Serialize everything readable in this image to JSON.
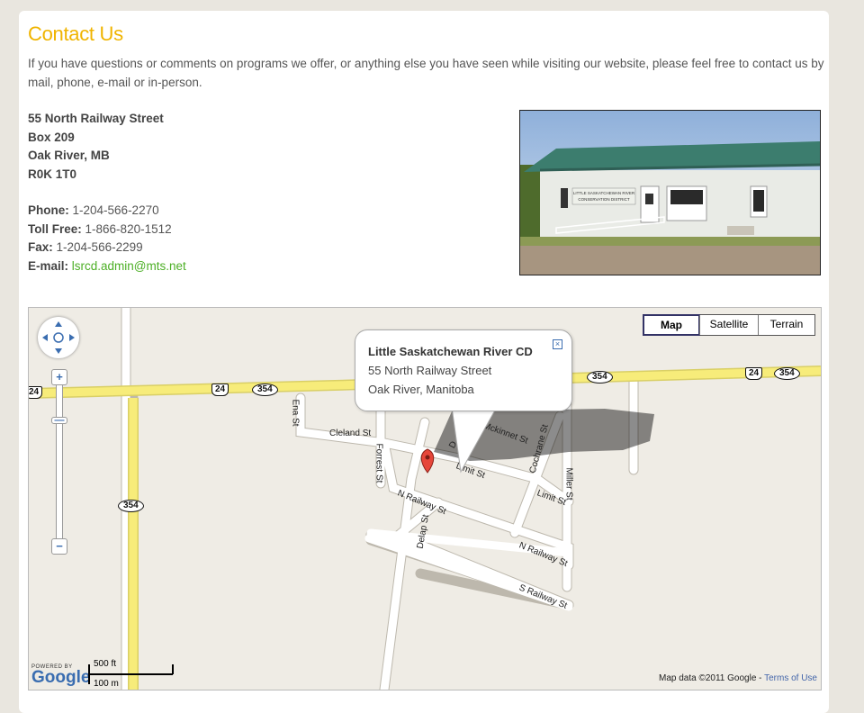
{
  "page": {
    "title": "Contact Us",
    "intro": "If you have questions or comments on programs we offer, or anything else you have seen while visiting our website, please feel free to contact us by mail, phone, e-mail or in-person."
  },
  "address": {
    "line1": "55 North Railway Street",
    "line2": "Box 209",
    "line3": "Oak River, MB",
    "line4": "R0K 1T0"
  },
  "contact": {
    "phone_label": "Phone:",
    "phone": "1-204-566-2270",
    "tollfree_label": "Toll Free:",
    "tollfree": "1-866-820-1512",
    "fax_label": "Fax:",
    "fax": "1-204-566-2299",
    "email_label": "E-mail:",
    "email": "lsrcd.admin@mts.net",
    "email_color": "#4caf25"
  },
  "photo": {
    "sign_line1": "LITTLE SASKATCHEWAN RIVER",
    "sign_line2": "CONSERVATION DISTRICT"
  },
  "map": {
    "type_buttons": [
      "Map",
      "Satellite",
      "Terrain"
    ],
    "zoom_in": "+",
    "zoom_out": "−",
    "bubble": {
      "title": "Little Saskatchewan River CD",
      "line1": "55 North Railway Street",
      "line2": "Oak River, Manitoba",
      "close": "×"
    },
    "shields": {
      "hwy24": "24",
      "hwy354": "354"
    },
    "streets": {
      "ena": "Ena St",
      "cleland": "Cleland St",
      "forrest": "Forrest St",
      "mckinnet": "Mckinnet St",
      "limit": "Limit St",
      "cochrane": "Cochrane St",
      "miller": "Miller St",
      "nrailway": "N Railway St",
      "delap": "Delap St",
      "srailway": "S Railway St",
      "d": "D"
    },
    "powered_by": "POWERED BY",
    "google": "Google",
    "scale_ft": "500 ft",
    "scale_m": "100 m",
    "mapdata": "Map data ©2011 Google - ",
    "terms": "Terms of Use"
  },
  "colors": {
    "title": "#f0b400",
    "highway": "#f7ec7a",
    "road": "#ffffff",
    "map_bg": "#efece5"
  }
}
